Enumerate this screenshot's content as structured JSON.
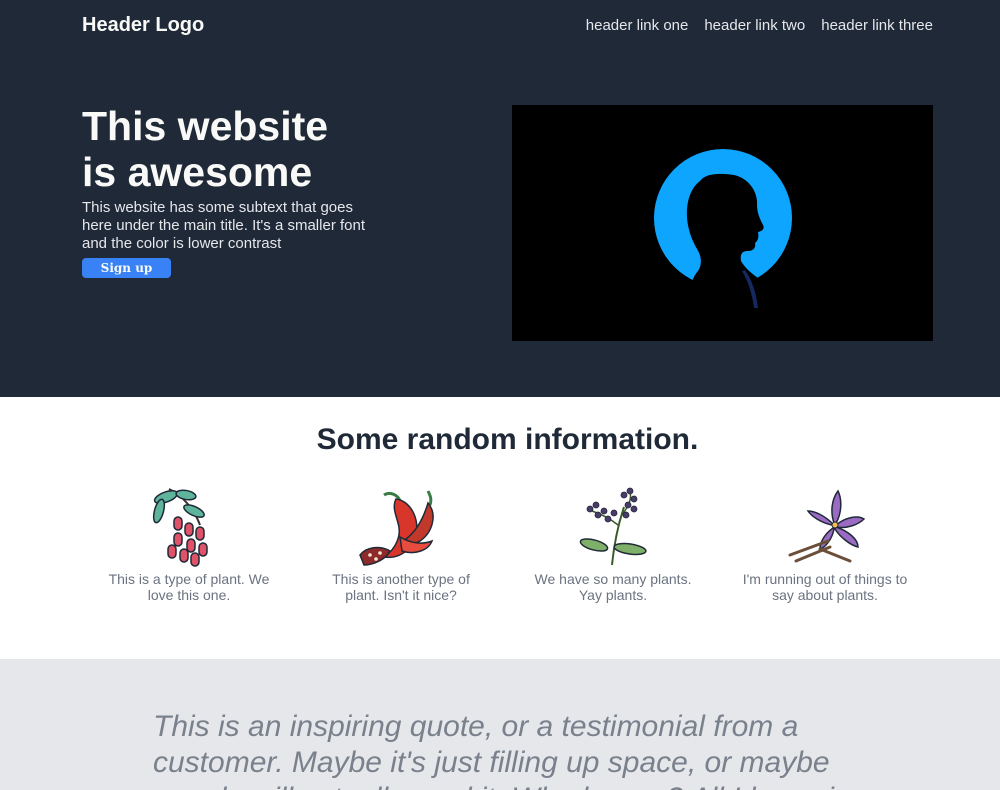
{
  "header": {
    "logo": "Header Logo",
    "links": [
      "header link one",
      "header link two",
      "header link three"
    ]
  },
  "hero": {
    "title_line1": "This website",
    "title_line2": "is awesome",
    "subtext": "This website has some subtext that goes here under the main title. It's a smaller font and the color is lower contrast",
    "signup_label": "Sign up",
    "image_icon": "silhouette-profile-image"
  },
  "info": {
    "title": "Some random information.",
    "items": [
      {
        "icon": "berry-branch-icon",
        "caption": "This is a type of plant. We love this one."
      },
      {
        "icon": "chili-pepper-icon",
        "caption": "This is another type of plant. Isn't it nice?"
      },
      {
        "icon": "elderberry-sprig-icon",
        "caption": "We have so many plants. Yay plants."
      },
      {
        "icon": "purple-flower-icon",
        "caption": "I'm running out of things to say about plants."
      }
    ]
  },
  "quote": {
    "text": "This is an inspiring quote, or a testimonial from a customer. Maybe it's just filling up space, or maybe people will actually read it. Who knows? All I know is"
  },
  "colors": {
    "hero_bg": "#1f2937",
    "button_blue": "#3882f6",
    "quote_bg": "#e5e7eb",
    "caption_gray": "#6b7280",
    "circle_blue": "#0ea5ff"
  }
}
